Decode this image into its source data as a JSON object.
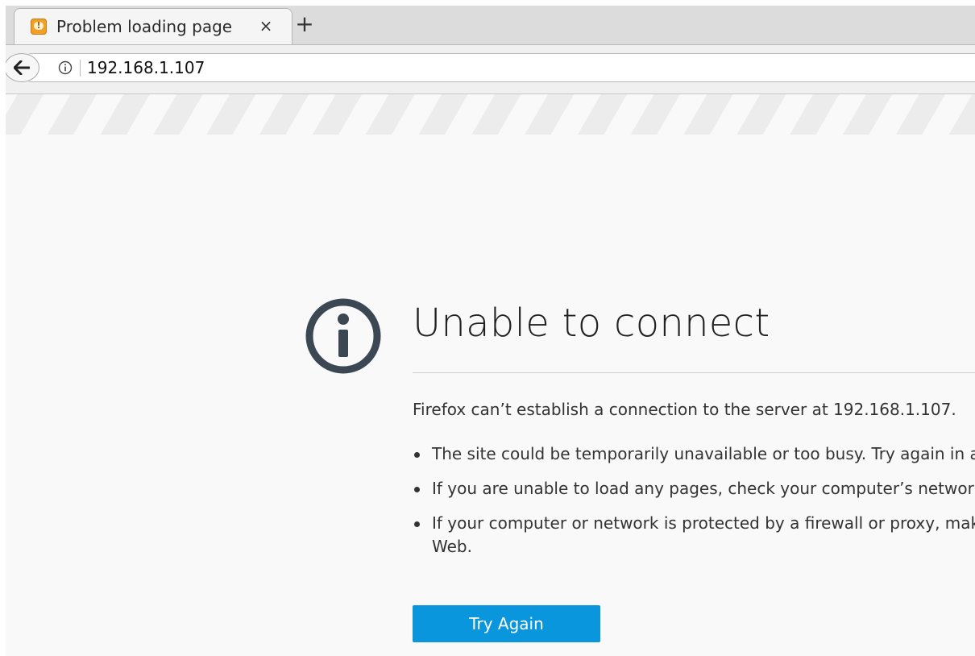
{
  "tabs": [
    {
      "title": "Problem loading page",
      "close_glyph": "×",
      "favicon": "error-favicon-icon"
    }
  ],
  "new_tab_glyph": "+",
  "navbar": {
    "url": "192.168.1.107",
    "identity_icon": "info-icon",
    "back_icon": "back-arrow-icon"
  },
  "error": {
    "icon": "info-circle-icon",
    "title": "Unable to connect",
    "description": "Firefox can’t establish a connection to the server at 192.168.1.107.",
    "reasons": [
      "The site could be temporarily unavailable or too busy. Try again in a",
      "If you are unable to load any pages, check your computer’s network",
      "If your computer or network is protected by a firewall or proxy, mak\nWeb."
    ],
    "button_label": "Try Again"
  },
  "colors": {
    "accent": "#0996dd",
    "icon_dark": "#3b4853",
    "page_background": "#f9f9fa"
  }
}
